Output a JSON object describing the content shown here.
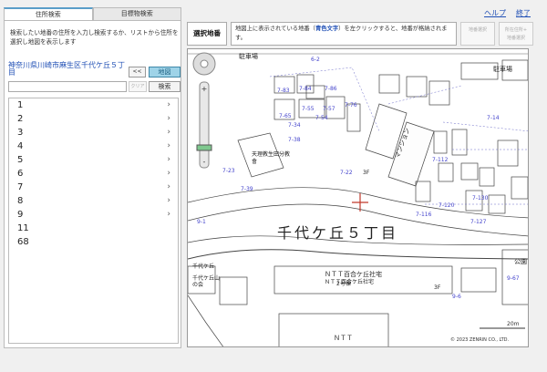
{
  "tabs": [
    "住所検索",
    "目標物検索"
  ],
  "left": {
    "instruction": "検索したい地番の住所を入力し検索するか、リストから住所を選択し地図を表示します",
    "address": "神奈川県川崎市麻生区千代ケ丘５丁目",
    "back_button": "<<",
    "map_button": "地図",
    "input_value": "",
    "clear_button": "クリア",
    "search_button": "検索"
  },
  "list": {
    "items": [
      {
        "label": "1",
        "chevron": "›"
      },
      {
        "label": "2",
        "chevron": "›"
      },
      {
        "label": "3",
        "chevron": "›"
      },
      {
        "label": "4",
        "chevron": "›"
      },
      {
        "label": "5",
        "chevron": "›"
      },
      {
        "label": "6",
        "chevron": "›"
      },
      {
        "label": "7",
        "chevron": "›"
      },
      {
        "label": "8",
        "chevron": "›"
      },
      {
        "label": "9",
        "chevron": "›"
      },
      {
        "label": "11",
        "chevron": ""
      },
      {
        "label": "68",
        "chevron": ""
      }
    ]
  },
  "header": {
    "select_label": "選択地番",
    "instruction_pre": "地図上に表示されている地番（",
    "instruction_hl": "青色文字",
    "instruction_post": "）を左クリックすると、地番が格納されます。",
    "btn_chiban_select": "地番選択",
    "btn_shozai_line1": "所在住所+",
    "btn_shozai_line2": "地番選択",
    "help_link": "ヘルプ",
    "exit_link": "終了"
  },
  "map": {
    "district_label": "千代ケ丘５丁目",
    "copyright": "© 2023 ZENRIN CO., LTD.",
    "scale_label": "20m",
    "place_labels": [
      "駐車場",
      "駐車場",
      "天理教生田分教會",
      "マンション",
      "ＮＴＴ百合ケ丘社宅",
      "ＮＴＴ",
      "千代ケ丘山の会",
      "ＮＴＴ百合ケ丘社宅",
      "公園",
      "千代ケ丘"
    ],
    "parcel_labels": [
      "6-2",
      "7-83",
      "7-84",
      "7-86",
      "7-76",
      "7-55",
      "7-57",
      "7-65",
      "7-54",
      "7-34",
      "7-38",
      "7-23",
      "7-39",
      "7-22",
      "7-112",
      "7-116",
      "7-120",
      "7-127",
      "7-130",
      "7-14",
      "9-1",
      "9-6",
      "9-67",
      "3F",
      "2号棟",
      "3F"
    ],
    "accent_color": "#4444cc"
  }
}
